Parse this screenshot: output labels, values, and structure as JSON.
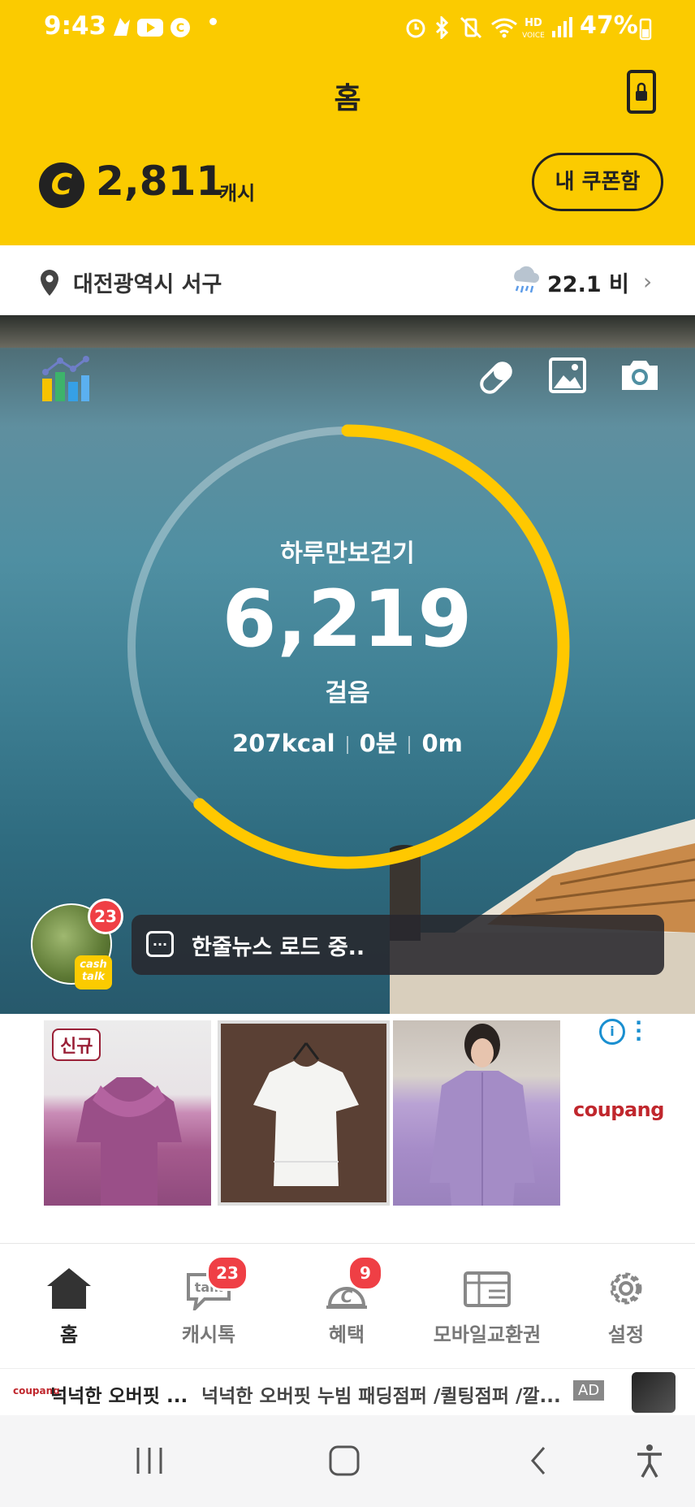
{
  "status_bar": {
    "time": "9:43",
    "battery": "47%"
  },
  "header": {
    "title": "홈",
    "cash_amount": "2,811",
    "cash_unit": "캐시",
    "coupon_button": "내 쿠폰함"
  },
  "location": {
    "place": "대전광역시 서구",
    "weather": "22.1 비"
  },
  "pedometer": {
    "title": "하루만보걷기",
    "steps": "6,219",
    "unit": "걸음",
    "kcal": "207kcal",
    "minutes": "0분",
    "distance": "0m",
    "progress": 0.62
  },
  "cashtalk": {
    "badge": "23",
    "tag": "cash talk",
    "news": "한줄뉴스 로드 중.."
  },
  "ad": {
    "new_badge": "신규",
    "brand": "coupang"
  },
  "bottom_nav": [
    {
      "label": "홈"
    },
    {
      "label": "캐시톡",
      "badge": "23"
    },
    {
      "label": "혜택",
      "badge": "9"
    },
    {
      "label": "모바일교환권"
    },
    {
      "label": "설정"
    }
  ],
  "ad_banner": {
    "brand": "coupang",
    "title": "넉넉한 오버핏 ...",
    "text": "넉넉한 오버핏 누빔 패딩점퍼 /퀼팅점퍼 /깔...",
    "ad_label": "AD"
  },
  "colors": {
    "brand_yellow": "#fbcb00",
    "badge_red": "#ef3f45",
    "ring_yellow": "#ffc800"
  }
}
